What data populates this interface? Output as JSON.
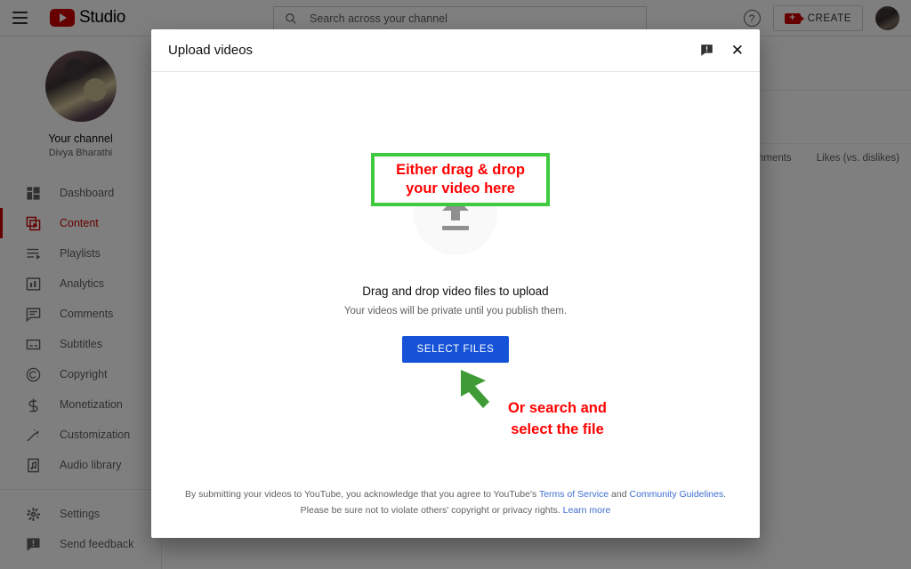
{
  "topbar": {
    "menu_icon": "hamburger-icon",
    "logo_text": "Studio",
    "search_placeholder": "Search across your channel",
    "search_icon": "search-icon",
    "help_icon": "help-circle-icon",
    "create_label": "CREATE",
    "create_icon": "video-camera-plus-icon",
    "avatar": "user-avatar"
  },
  "sidebar": {
    "channel_title": "Your channel",
    "channel_name": "Divya Bharathi",
    "items": [
      {
        "label": "Dashboard",
        "icon": "dashboard-icon",
        "active": false
      },
      {
        "label": "Content",
        "icon": "content-video-icon",
        "active": true
      },
      {
        "label": "Playlists",
        "icon": "playlists-icon",
        "active": false
      },
      {
        "label": "Analytics",
        "icon": "analytics-bar-icon",
        "active": false
      },
      {
        "label": "Comments",
        "icon": "comments-icon",
        "active": false
      },
      {
        "label": "Subtitles",
        "icon": "subtitles-icon",
        "active": false
      },
      {
        "label": "Copyright",
        "icon": "copyright-icon",
        "active": false
      },
      {
        "label": "Monetization",
        "icon": "dollar-icon",
        "active": false
      },
      {
        "label": "Customization",
        "icon": "magic-wand-icon",
        "active": false
      },
      {
        "label": "Audio library",
        "icon": "audio-library-icon",
        "active": false
      }
    ],
    "footer_items": [
      {
        "label": "Settings",
        "icon": "gear-icon"
      },
      {
        "label": "Send feedback",
        "icon": "feedback-icon"
      }
    ]
  },
  "background_page": {
    "table_headers": [
      "Comments",
      "Likes (vs. dislikes)"
    ]
  },
  "modal": {
    "title": "Upload videos",
    "feedback_icon": "feedback-icon",
    "close_icon": "close-icon",
    "upload_icon": "upload-arrow-icon",
    "dropzone_title": "Drag and drop video files to upload",
    "dropzone_subtitle": "Your videos will be private until you publish them.",
    "select_files_label": "SELECT FILES",
    "footer": {
      "line1_part1": "By submitting your videos to YouTube, you acknowledge that you agree to YouTube's ",
      "line1_link1": "Terms of Service",
      "line1_part2": " and ",
      "line1_link2": "Community Guidelines",
      "line1_part3": ".",
      "line2_part1": "Please be sure not to violate others' copyright or privacy rights. ",
      "line2_link": "Learn more"
    }
  },
  "annotations": {
    "box_line1": "Either drag & drop",
    "box_line2": "your video here",
    "box_border_color": "#3ec93e",
    "text_color": "#ff0000",
    "arrow_color": "#3f9b35",
    "callout_line1": "Or search and",
    "callout_line2": "select the file"
  }
}
